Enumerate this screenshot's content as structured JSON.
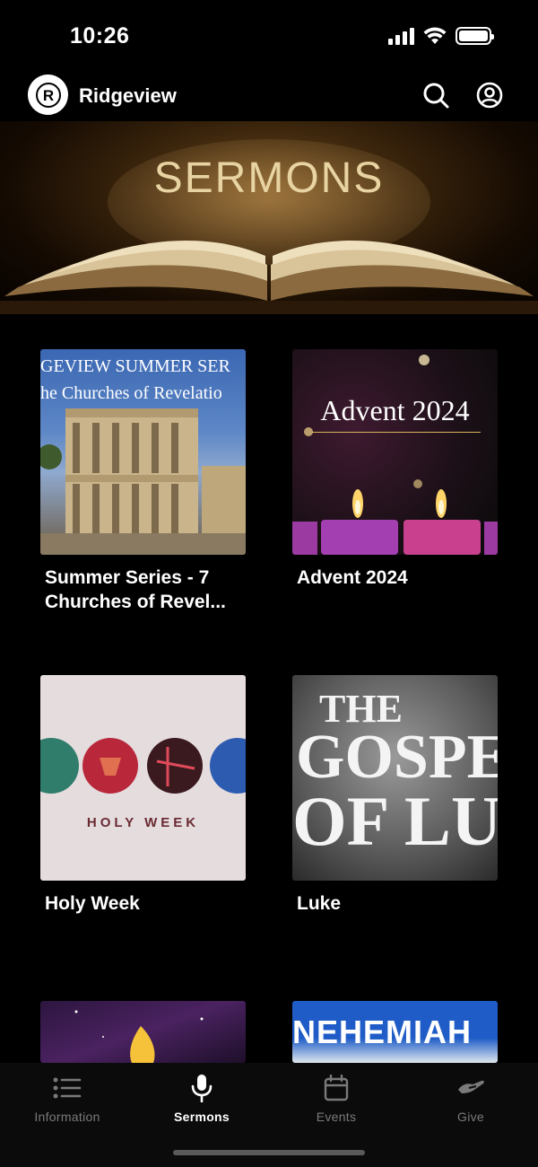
{
  "status": {
    "time": "10:26"
  },
  "header": {
    "app_name": "Ridgeview",
    "logo_letter": "R"
  },
  "hero": {
    "title": "SERMONS"
  },
  "series": [
    {
      "title": "Summer Series - 7 Churches of Revel...",
      "art_line1": "GEVIEW SUMMER SER",
      "art_line2": "he Churches of Revelatio"
    },
    {
      "title": "Advent 2024",
      "art_line1": "Advent 2024"
    },
    {
      "title": "Holy Week",
      "art_line1": "HOLY WEEK"
    },
    {
      "title": "Luke",
      "art_line1": "THE",
      "art_line2": "GOSPEL",
      "art_line3": "OF LUKE"
    },
    {
      "title": "",
      "art_line1": ""
    },
    {
      "title": "",
      "art_line1": "NEHEMIAH"
    }
  ],
  "tabs": [
    {
      "label": "Information",
      "icon": "list-icon",
      "active": false
    },
    {
      "label": "Sermons",
      "icon": "microphone-icon",
      "active": true
    },
    {
      "label": "Events",
      "icon": "calendar-icon",
      "active": false
    },
    {
      "label": "Give",
      "icon": "hand-give-icon",
      "active": false
    }
  ],
  "colors": {
    "background": "#000000",
    "tab_active": "#ffffff",
    "tab_inactive": "#7a7a7a"
  }
}
